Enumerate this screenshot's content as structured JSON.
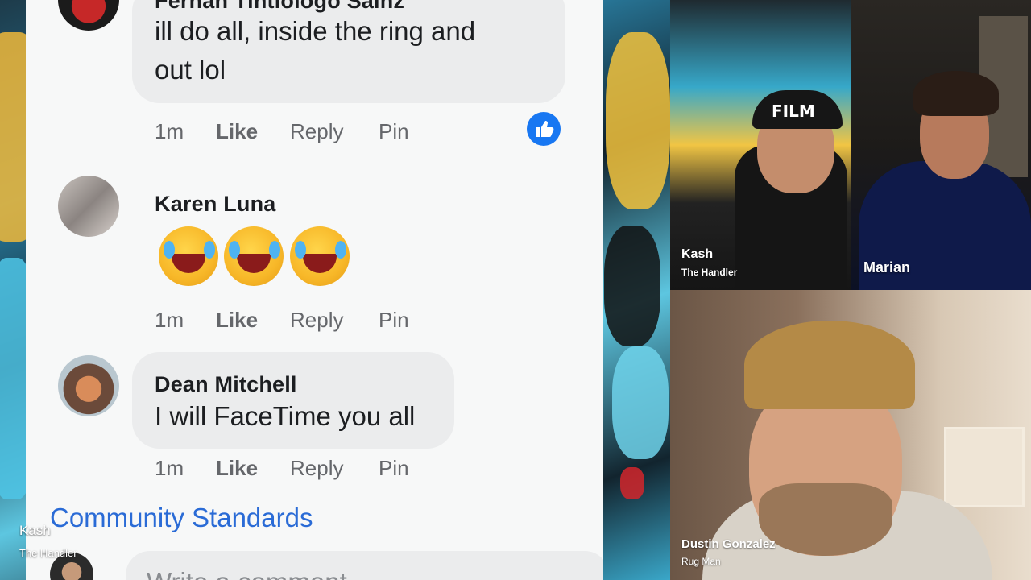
{
  "comments": [
    {
      "author": "Fernan Tintiologo Sainz",
      "lines": [
        "ill do all, inside the ring and",
        "out lol"
      ],
      "time": "1m",
      "like": "Like",
      "reply": "Reply",
      "pin": "Pin",
      "has_like_badge": true
    },
    {
      "author": "Karen Luna",
      "emoji": [
        "rolling-on-floor-laughing",
        "rolling-on-floor-laughing",
        "rolling-on-floor-laughing"
      ],
      "time": "1m",
      "like": "Like",
      "reply": "Reply",
      "pin": "Pin"
    },
    {
      "author": "Dean Mitchell",
      "lines": [
        "I will FaceTime you all"
      ],
      "time": "1m",
      "like": "Like",
      "reply": "Reply",
      "pin": "Pin"
    }
  ],
  "community_link": "Community Standards",
  "write_placeholder": "Write a comment",
  "host_overlay": {
    "name": "Kash",
    "subtitle": "The Handler"
  },
  "participants": [
    {
      "name": "Kash",
      "subtitle": "The Handler",
      "cap_text": "FILM"
    },
    {
      "name": "Marian"
    },
    {
      "name": "Dustin Gonzalez",
      "subtitle": "Rug Man"
    }
  ],
  "colors": {
    "link": "#2a6bd6",
    "like_badge": "#1877f2",
    "action_text": "#65676b",
    "bubble": "#ebeced"
  }
}
